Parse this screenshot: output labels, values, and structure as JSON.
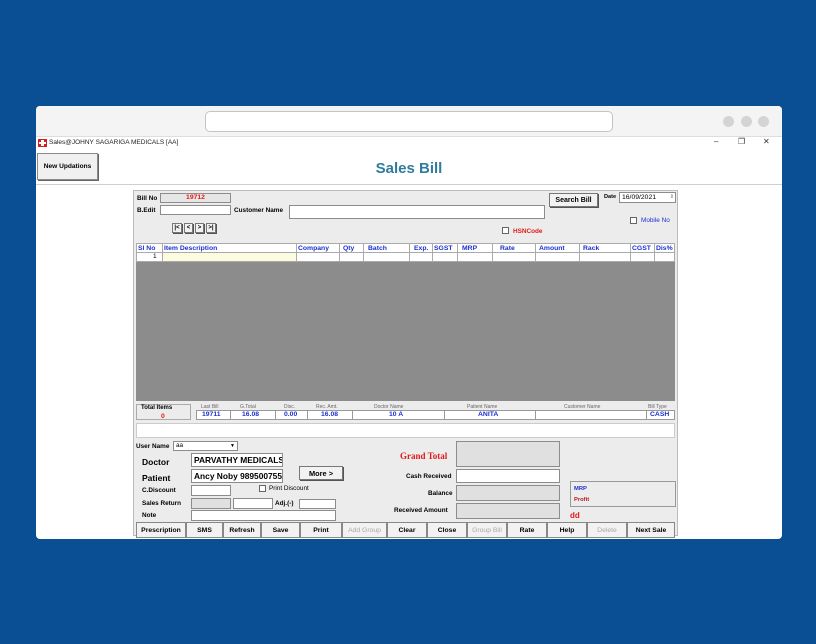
{
  "window": {
    "title": "Sales@JOHNY SAGARIGA MEDICALS  [AA]",
    "minimize_glyph": "–",
    "restore_glyph": "❐",
    "close_glyph": "✕"
  },
  "header": {
    "new_updations": "New Updations",
    "title": "Sales Bill"
  },
  "bill": {
    "bill_no_label": "Bill No",
    "bill_no": "19712",
    "b_edit_label": "B.Edit",
    "customer_name_label": "Customer Name",
    "customer_name": "",
    "search_bill": "Search Bill",
    "date_label": "Date",
    "date": "16/09/2021",
    "mobile_no_label": "Mobile No",
    "hsn_label": "HSNCode",
    "nav_buttons": [
      "|<",
      "<",
      ">",
      ">|"
    ]
  },
  "grid": {
    "columns": [
      "Sl No",
      "Item Description",
      "Company",
      "Qty",
      "Batch",
      "Exp.",
      "SGST",
      "MRP",
      "Rate",
      "Amount",
      "Rack",
      "CGST",
      "Dis%"
    ],
    "rows": [
      [
        "1",
        "",
        "",
        "",
        "",
        "",
        "",
        "",
        "",
        "",
        "",
        "",
        ""
      ]
    ]
  },
  "summary": {
    "total_items_label": "Total Items",
    "total_items": "0",
    "headers": [
      "Last Bill",
      "G.Total",
      "Disc.",
      "Rec. Amt.",
      "Doctor Name",
      "Patient Name",
      "Customer Name",
      "Bill Type"
    ],
    "values": [
      "19711",
      "16.08",
      "0.00",
      "16.08",
      "10 A",
      "ANITA",
      "",
      "CASH"
    ]
  },
  "lower": {
    "user_name_label": "User Name",
    "user_name": "aa",
    "doctor_label": "Doctor",
    "doctor": "PARVATHY MEDICALS",
    "patient_label": "Patient",
    "patient": "Ancy Noby 989500755",
    "more_button": "More >",
    "c_discount_label": "C.Discount",
    "print_discount_label": "Print Discount",
    "sales_return_label": "Sales Return",
    "adj_label": "Adj.(-)",
    "note_label": "Note",
    "grand_total_label": "Grand Total",
    "cash_received_label": "Cash Received",
    "balance_label": "Balance",
    "received_amount_label": "Received Amount",
    "dd_label": "dd",
    "mrp_label": "MRP",
    "profit_label": "Profit"
  },
  "buttons": [
    {
      "label": "Prescription",
      "enabled": true
    },
    {
      "label": "SMS",
      "enabled": true
    },
    {
      "label": "Refresh",
      "enabled": true
    },
    {
      "label": "Save",
      "enabled": true
    },
    {
      "label": "Print",
      "enabled": true
    },
    {
      "label": "Add Group",
      "enabled": false
    },
    {
      "label": "Clear",
      "enabled": true
    },
    {
      "label": "Close",
      "enabled": true
    },
    {
      "label": "Group Bill",
      "enabled": false
    },
    {
      "label": "Rate",
      "enabled": true
    },
    {
      "label": "Help",
      "enabled": true
    },
    {
      "label": "Delete",
      "enabled": false
    },
    {
      "label": "Next Sale",
      "enabled": true
    }
  ],
  "colors": {
    "title": "#2f7c9c",
    "grid_header_text": "#1a2fd0",
    "bill_no": "#e01a1a",
    "grand_total": "#e01a1a",
    "background": "#0a4f94"
  }
}
